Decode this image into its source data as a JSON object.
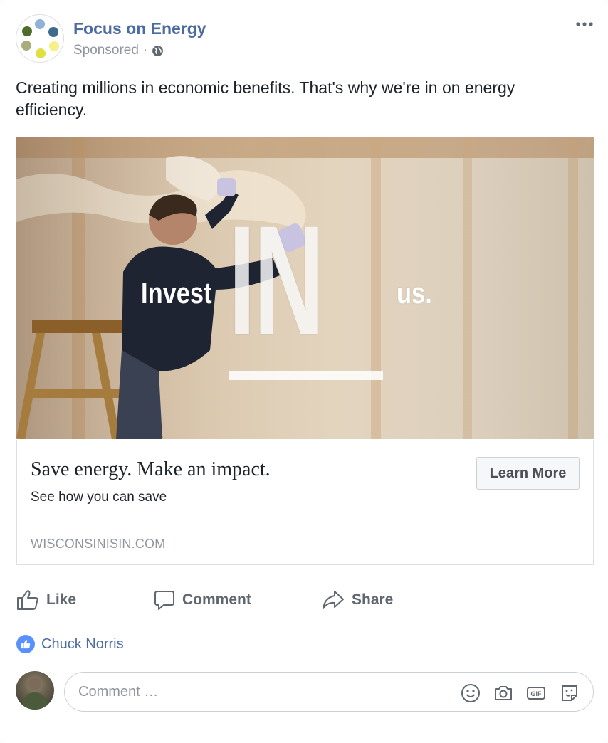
{
  "post": {
    "page_name": "Focus on Energy",
    "sponsored_label": "Sponsored",
    "separator": "·",
    "text": "Creating millions in economic benefits. That's why we're in on energy efficiency."
  },
  "hero": {
    "word_left": "Invest",
    "word_center": "IN",
    "word_right": "us."
  },
  "link": {
    "title": "Save energy. Make an impact.",
    "subtitle": "See how you can save",
    "domain": "WISCONSINISIN.COM",
    "cta_label": "Learn More"
  },
  "actions": {
    "like": "Like",
    "comment": "Comment",
    "share": "Share"
  },
  "liked_by": "Chuck Norris",
  "comment_input": {
    "placeholder": "Comment …"
  },
  "icons": {
    "more": "more-options-icon",
    "globe": "globe-icon",
    "like": "thumbs-up-icon",
    "comment": "speech-bubble-icon",
    "share": "share-arrow-icon",
    "emoji": "emoji-icon",
    "camera": "camera-icon",
    "gif": "gif-icon",
    "sticker": "sticker-icon"
  },
  "colors": {
    "link_blue": "#4b6ba3",
    "muted_gray": "#90949c",
    "action_gray": "#606770",
    "like_badge": "#5890ff",
    "border": "#dddfe2"
  }
}
